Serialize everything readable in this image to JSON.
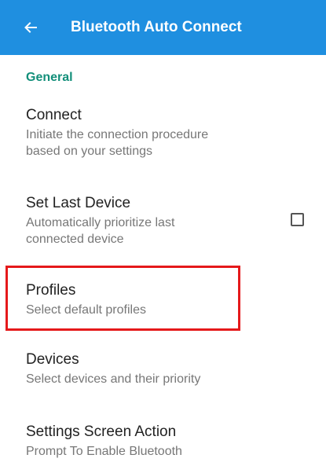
{
  "app_bar": {
    "title": "Bluetooth Auto Connect",
    "back_icon": "arrow-left-icon",
    "color": "#1f8fe0"
  },
  "section": {
    "header": "General",
    "header_color": "#138f7a"
  },
  "preferences": [
    {
      "title": "Connect",
      "summary_line1": "Initiate the connection procedure",
      "summary_line2": "based on your settings"
    },
    {
      "title": "Set Last Device",
      "summary_line1": "Automatically prioritize last",
      "summary_line2": "connected device",
      "checked": false
    },
    {
      "title": "Profiles",
      "summary_line1": "Select default profiles"
    },
    {
      "title": "Devices",
      "summary_line1": "Select devices and their priority"
    },
    {
      "title": "Settings Screen Action",
      "summary_line1": "Prompt To Enable Bluetooth"
    }
  ],
  "highlight_color": "#e5191b"
}
